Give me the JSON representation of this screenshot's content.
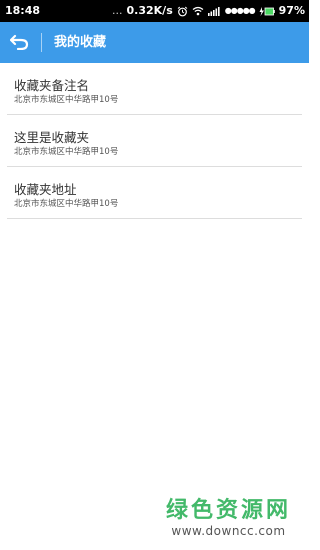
{
  "status_bar": {
    "time": "18:48",
    "separator": "...",
    "speed": "0.32K/s",
    "carrier_signal": "●●●●●",
    "battery": "97%"
  },
  "header": {
    "title": "我的收藏",
    "back_icon": "back-arrow-icon"
  },
  "favorites": [
    {
      "name": "收藏夹备注名",
      "address": "北京市东城区中华路甲10号"
    },
    {
      "name": "这里是收藏夹",
      "address": "北京市东城区中华路甲10号"
    },
    {
      "name": "收藏夹地址",
      "address": "北京市东城区中华路甲10号"
    }
  ],
  "watermark": {
    "chinese": "绿色资源网",
    "url": "www.downcc.com"
  },
  "colors": {
    "header_bg": "#3d9be9",
    "status_bar_bg": "#000000",
    "watermark_green": "#2fb25a"
  }
}
